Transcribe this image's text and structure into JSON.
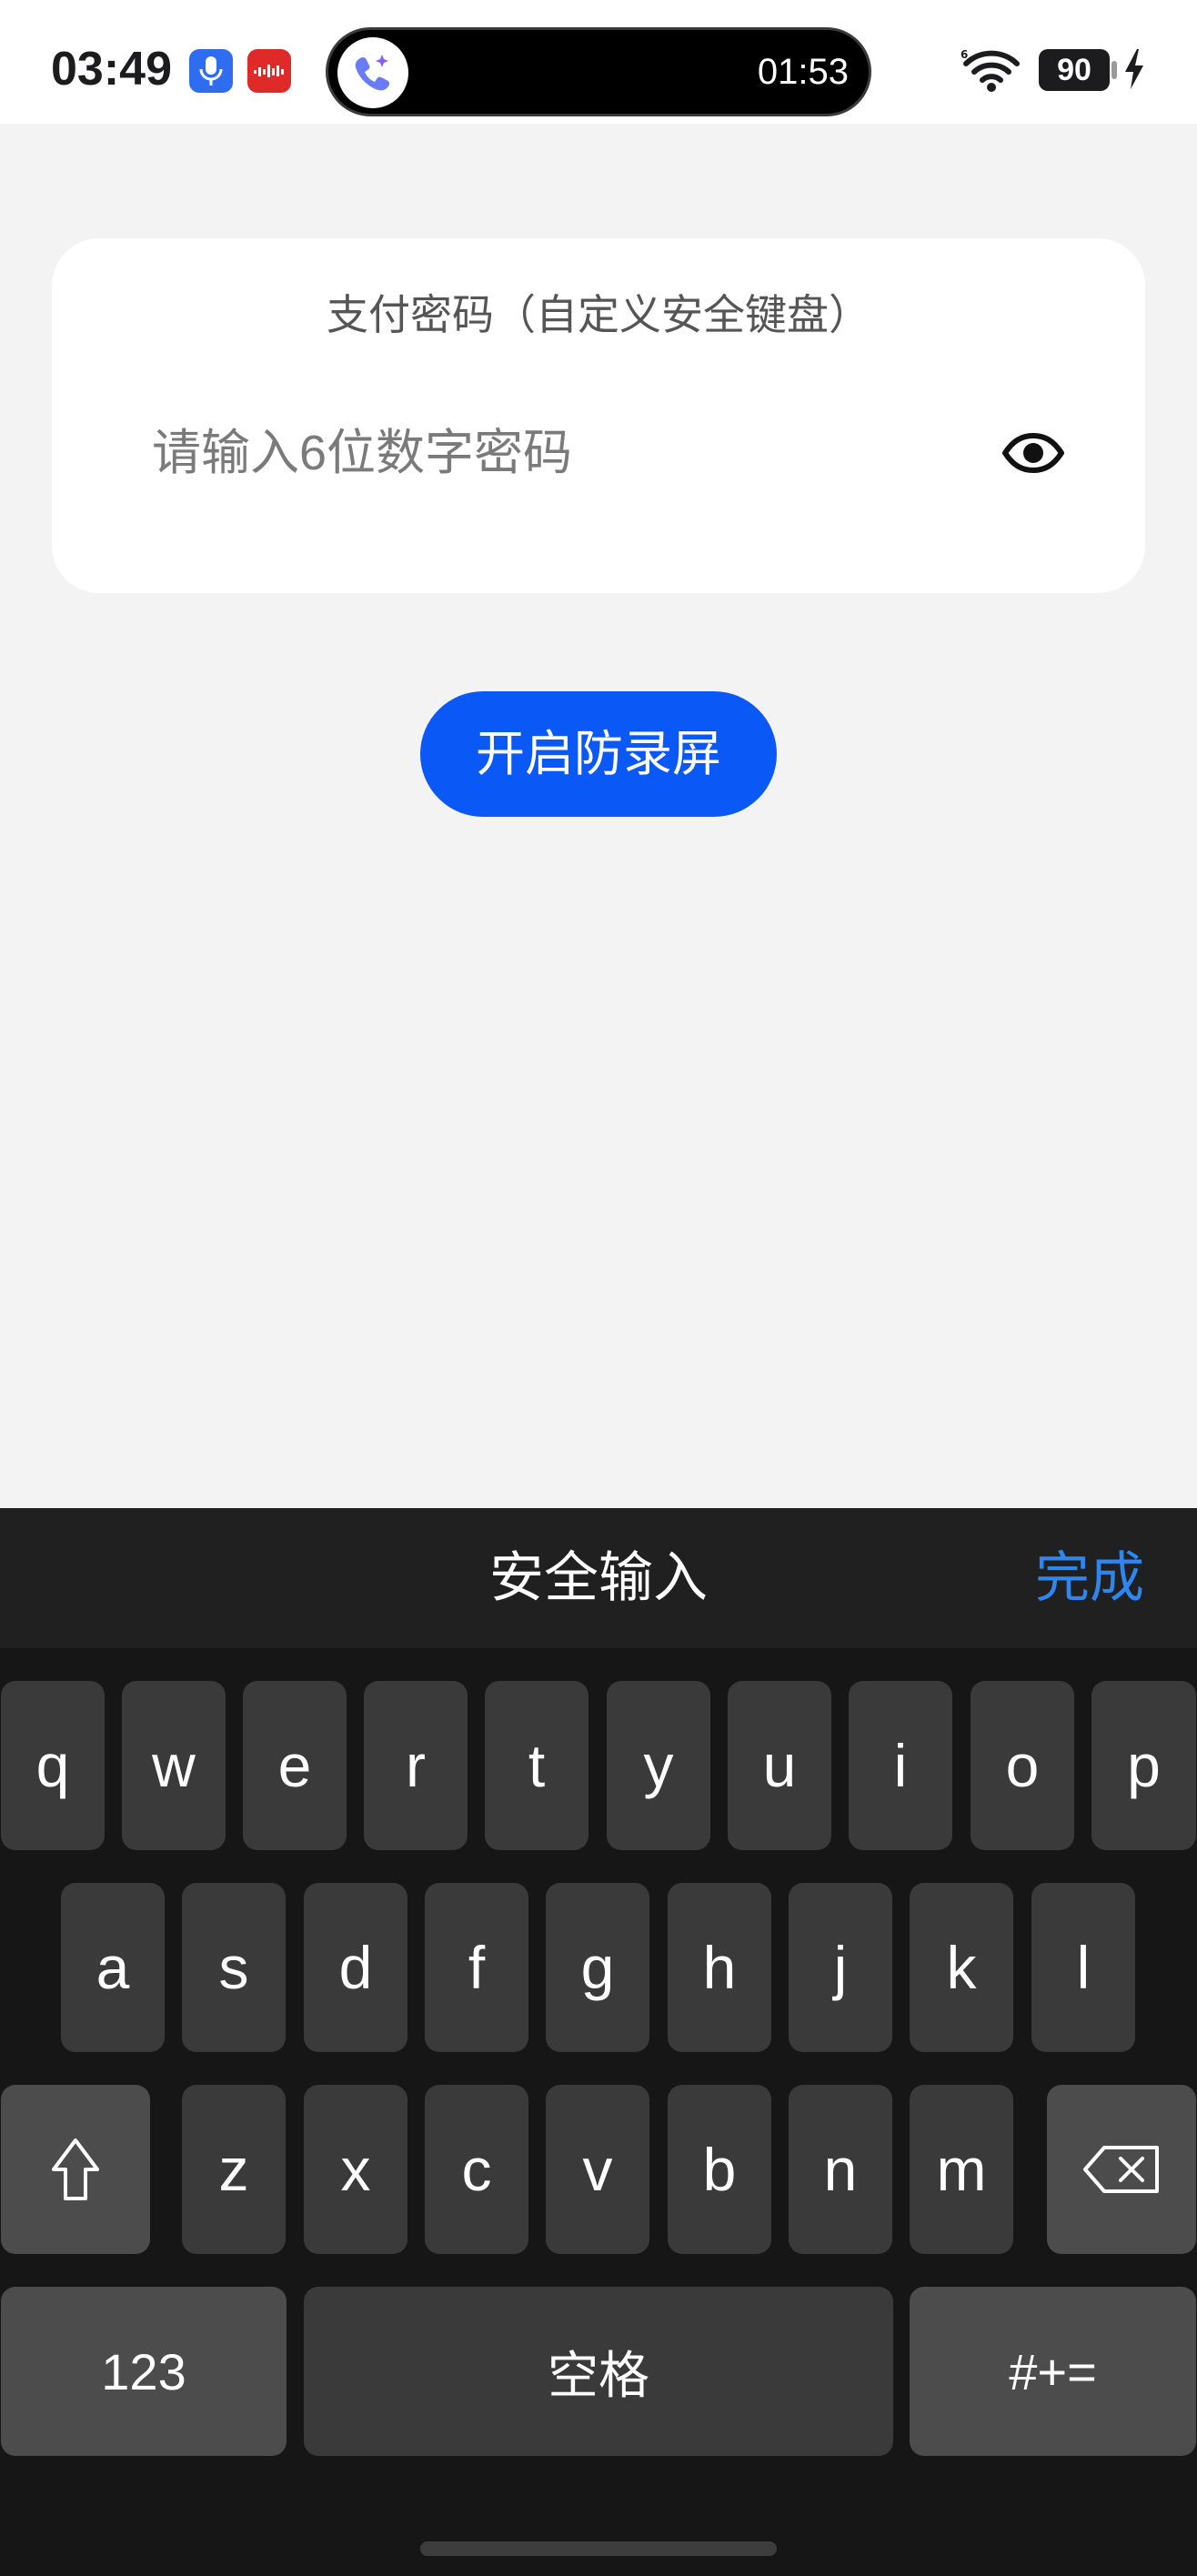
{
  "status_bar": {
    "time": "03:49",
    "island_timer": "01:53",
    "battery": "90",
    "icons": [
      "microphone-icon",
      "recorder-app-icon",
      "phone-sparkle-icon",
      "wifi-6-icon",
      "charging-bolt-icon"
    ]
  },
  "card": {
    "title": "支付密码（自定义安全键盘）",
    "input_placeholder": "请输入6位数字密码",
    "input_value": "",
    "toggle_icon": "eye-icon"
  },
  "action_button": {
    "label": "开启防录屏"
  },
  "keyboard": {
    "title": "安全输入",
    "done_label": "完成",
    "row1": [
      "q",
      "w",
      "e",
      "r",
      "t",
      "y",
      "u",
      "i",
      "o",
      "p"
    ],
    "row2": [
      "a",
      "s",
      "d",
      "f",
      "g",
      "h",
      "j",
      "k",
      "l"
    ],
    "row3": [
      "z",
      "x",
      "c",
      "v",
      "b",
      "n",
      "m"
    ],
    "numbers_label": "123",
    "space_label": "空格",
    "symbols_label": "#+="
  },
  "colors": {
    "accent_blue": "#0a59f7",
    "done_blue": "#2d87f0",
    "page_bg": "#f3f3f4",
    "keyboard_bg": "#161616",
    "key_bg": "#3a3a3a"
  }
}
